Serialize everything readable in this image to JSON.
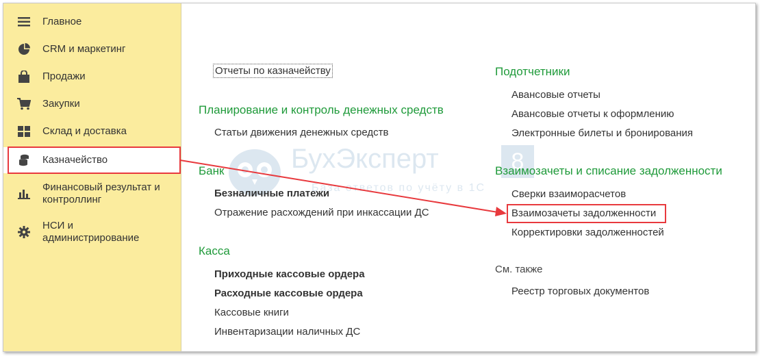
{
  "sidebar": {
    "items": [
      {
        "label": "Главное",
        "icon": "menu-icon"
      },
      {
        "label": "CRM и маркетинг",
        "icon": "pie-chart-icon"
      },
      {
        "label": "Продажи",
        "icon": "shopping-bag-icon"
      },
      {
        "label": "Закупки",
        "icon": "shopping-cart-icon"
      },
      {
        "label": "Склад и доставка",
        "icon": "warehouse-icon"
      },
      {
        "label": "Казначейство",
        "icon": "coins-icon",
        "active": true
      },
      {
        "label": "Финансовый результат и контроллинг",
        "icon": "bar-chart-icon"
      },
      {
        "label": "НСИ и администрирование",
        "icon": "gear-icon"
      }
    ]
  },
  "content": {
    "reports_link": "Отчеты по казначейству",
    "planning": {
      "title": "Планирование и контроль денежных средств",
      "items": [
        "Статьи движения денежных средств"
      ]
    },
    "bank": {
      "title": "Банк",
      "items": [
        "Безналичные платежи",
        "Отражение расхождений при инкассации ДС"
      ]
    },
    "cash": {
      "title": "Касса",
      "items": [
        "Приходные кассовые ордера",
        "Расходные кассовые ордера",
        "Кассовые книги",
        "Инвентаризации наличных ДС"
      ]
    },
    "accountable": {
      "title": "Подотчетники",
      "items": [
        "Авансовые отчеты",
        "Авансовые отчеты к оформлению",
        "Электронные билеты и бронирования"
      ]
    },
    "offsets": {
      "title": "Взаимозачеты и списание задолженности",
      "items": [
        "Сверки взаиморасчетов",
        "Взаимозачеты задолженности",
        "Корректировки задолженностей"
      ]
    },
    "see_also": {
      "title": "См. также",
      "items": [
        "Реестр торговых документов"
      ]
    }
  },
  "watermark": {
    "title": "БухЭксперт",
    "digit": "8",
    "subtitle": "База ответов по учёту в 1С"
  },
  "colors": {
    "sidebar_bg": "#fbec9e",
    "section_title": "#1f9a3a",
    "highlight": "#e8393d"
  }
}
